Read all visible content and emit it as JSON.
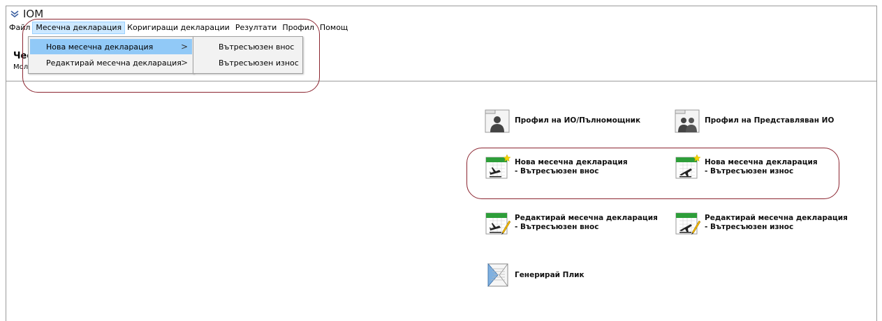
{
  "window": {
    "title": "IOM"
  },
  "menubar": {
    "items": [
      {
        "label": "Файл"
      },
      {
        "label": "Месечна декларация"
      },
      {
        "label": "Коригиращи декларации"
      },
      {
        "label": "Резултати"
      },
      {
        "label": "Профил"
      },
      {
        "label": "Помощ"
      }
    ]
  },
  "header": {
    "title": "Чес",
    "subtitle": "Моля"
  },
  "dropdown": {
    "items": [
      {
        "label": "Нова месечна декларация",
        "arrow": ">"
      },
      {
        "label": "Редактирай месечна декларация",
        "arrow": ">"
      }
    ],
    "submenu": [
      {
        "label": "Вътресъюзен внос"
      },
      {
        "label": "Вътресъюзен износ"
      }
    ]
  },
  "cards": {
    "profile_io": {
      "label": "Профил на ИО/Пълномощник",
      "icon": "person-folder-icon"
    },
    "profile_rep": {
      "label": "Профил на Представляван ИО",
      "icon": "people-folder-icon"
    },
    "new_import": {
      "label": "Нова месечна декларация\n- Вътресъюзен внос",
      "icon": "new-import-declaration-icon"
    },
    "new_export": {
      "label": "Нова месечна декларация\n- Вътресъюзен износ",
      "icon": "new-export-declaration-icon"
    },
    "edit_import": {
      "label": "Редактирай месечна декларация\n- Вътресъюзен внос",
      "icon": "edit-import-declaration-icon"
    },
    "edit_export": {
      "label": "Редактирай месечна декларация\n- Вътресъюзен износ",
      "icon": "edit-export-declaration-icon"
    },
    "envelope": {
      "label": "Генерирай Плик",
      "icon": "envelope-icon"
    }
  },
  "colors": {
    "menu_highlight": "#91c9f7",
    "menubar_active": "#cce8ff",
    "callout": "#8b2530",
    "calendar_green": "#2e9e3a"
  }
}
